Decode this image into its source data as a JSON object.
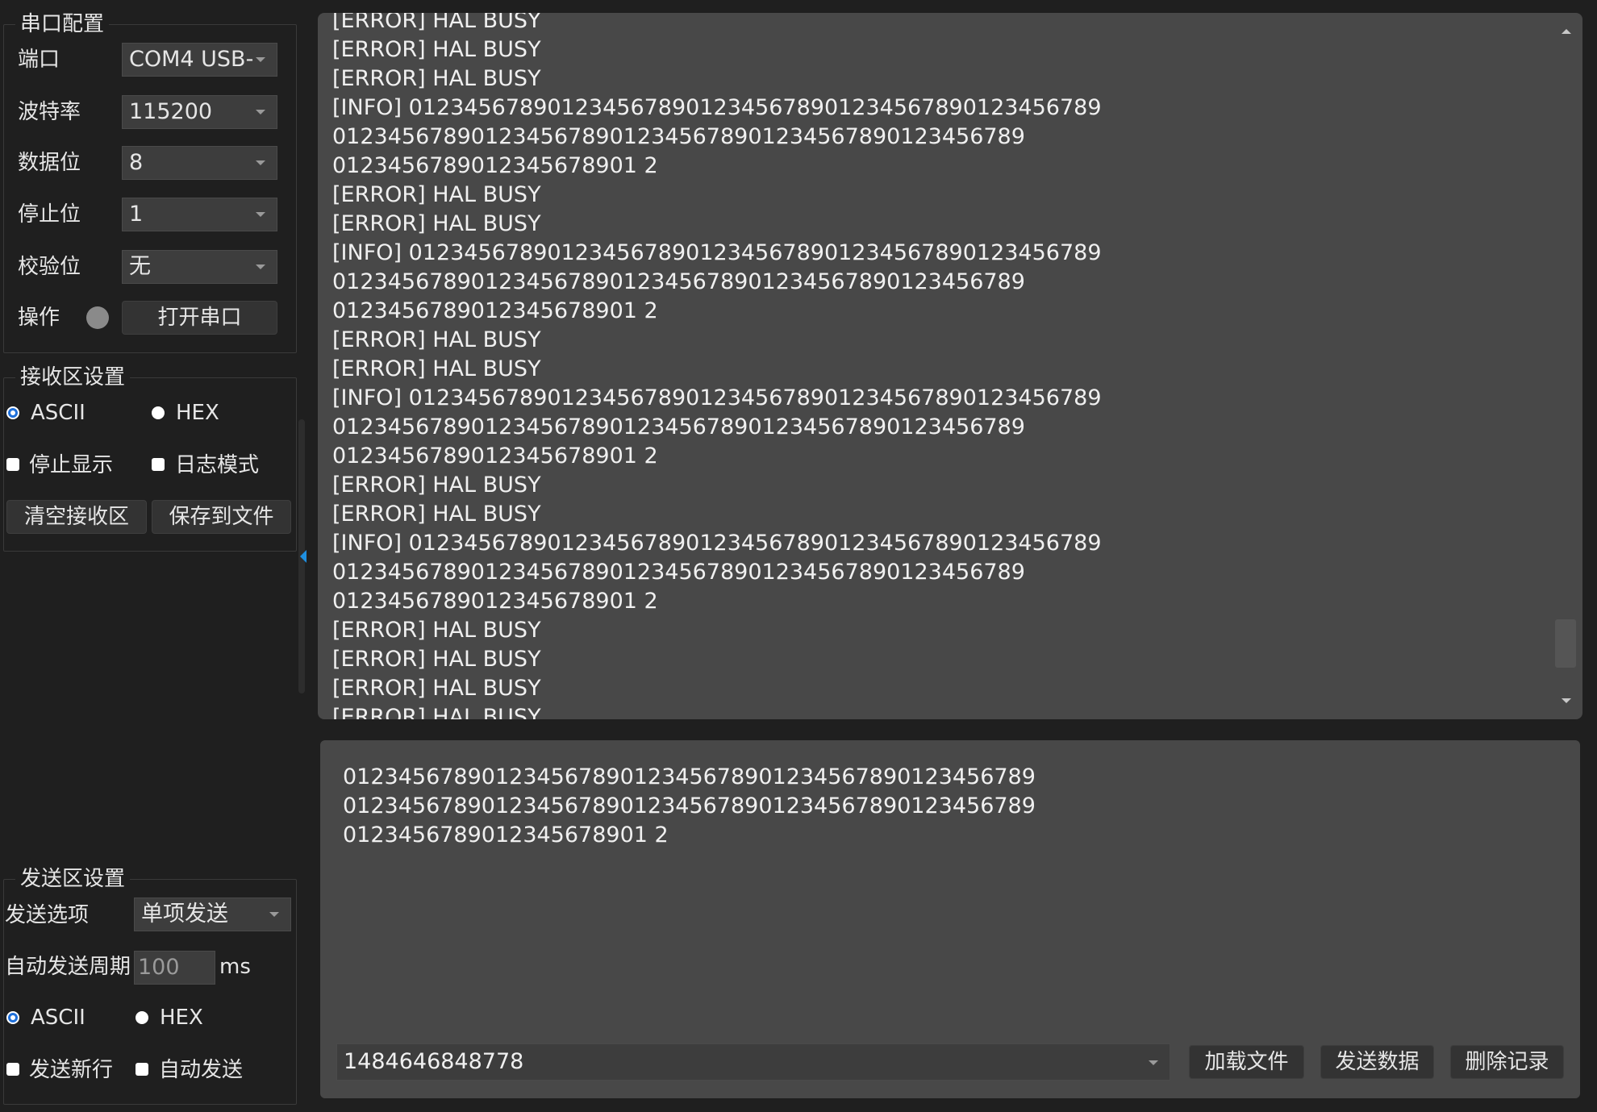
{
  "serial_config": {
    "title": "串口配置",
    "port_label": "端口",
    "port_value": "COM4 USB-",
    "baud_label": "波特率",
    "baud_value": "115200",
    "databits_label": "数据位",
    "databits_value": "8",
    "stopbits_label": "停止位",
    "stopbits_value": "1",
    "parity_label": "校验位",
    "parity_value": "无",
    "operation_label": "操作",
    "open_button": "打开串口"
  },
  "receive_settings": {
    "title": "接收区设置",
    "ascii_label": "ASCII",
    "hex_label": "HEX",
    "selected": "ASCII",
    "stop_display_label": "停止显示",
    "log_mode_label": "日志模式",
    "clear_button": "清空接收区",
    "save_button": "保存到文件"
  },
  "send_settings": {
    "title": "发送区设置",
    "option_label": "发送选项",
    "option_value": "单项发送",
    "period_label": "自动发送周期",
    "period_value": "100",
    "period_unit": "ms",
    "ascii_label": "ASCII",
    "hex_label": "HEX",
    "selected": "ASCII",
    "newline_label": "发送新行",
    "auto_send_label": "自动发送"
  },
  "receive_area": {
    "lines": [
      "[ERROR] HAL BUSY",
      "[ERROR] HAL BUSY",
      "[ERROR] HAL BUSY",
      "[INFO] 01234567890123456789012345678901234567890123456789",
      "01234567890123456789012345678901234567890123456789",
      "0123456789012345678901 2",
      "[ERROR] HAL BUSY",
      "[ERROR] HAL BUSY",
      "[INFO] 01234567890123456789012345678901234567890123456789",
      "01234567890123456789012345678901234567890123456789",
      "0123456789012345678901 2",
      "[ERROR] HAL BUSY",
      "[ERROR] HAL BUSY",
      "[INFO] 01234567890123456789012345678901234567890123456789",
      "01234567890123456789012345678901234567890123456789",
      "0123456789012345678901 2",
      "[ERROR] HAL BUSY",
      "[ERROR] HAL BUSY",
      "[INFO] 01234567890123456789012345678901234567890123456789",
      "01234567890123456789012345678901234567890123456789",
      "0123456789012345678901 2",
      "[ERROR] HAL BUSY",
      "[ERROR] HAL BUSY",
      "[ERROR] HAL BUSY",
      "[ERROR] HAL BUSY"
    ]
  },
  "send_area": {
    "lines": [
      "01234567890123456789012345678901234567890123456789",
      "01234567890123456789012345678901234567890123456789",
      "0123456789012345678901 2"
    ],
    "history_value": "1484646848778",
    "load_file_button": "加载文件",
    "send_button": "发送数据",
    "delete_button": "删除记录"
  },
  "colors": {
    "background": "#1f1f1f",
    "text_area": "#484848",
    "accent": "#1e6fd9",
    "led_off": "#8a8a8a"
  }
}
